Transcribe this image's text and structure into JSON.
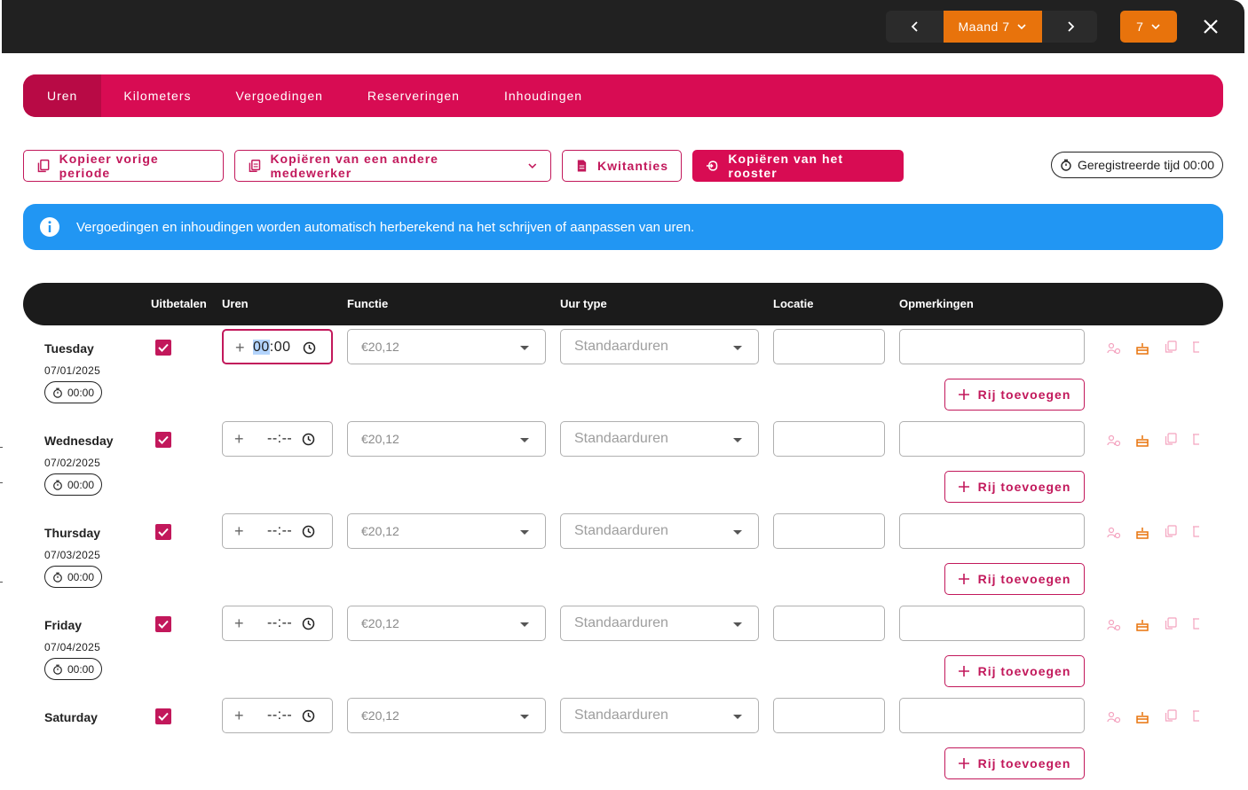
{
  "header": {
    "month_label": "Maand 7",
    "week_label": "7"
  },
  "tabs": [
    {
      "label": "Uren",
      "active": true
    },
    {
      "label": "Kilometers",
      "active": false
    },
    {
      "label": "Vergoedingen",
      "active": false
    },
    {
      "label": "Reserveringen",
      "active": false
    },
    {
      "label": "Inhoudingen",
      "active": false
    }
  ],
  "actions": {
    "copy_previous": "Kopieer vorige periode",
    "copy_other_employee": "Kopiëren van een andere medewerker",
    "receipts": "Kwitanties",
    "copy_schedule": "Kopiëren van het rooster",
    "registered_time": "Geregistreerde tijd 00:00"
  },
  "info_message": "Vergoedingen en inhoudingen worden automatisch herberekend na het schrijven of aanpassen van uren.",
  "table_headers": {
    "payout": "Uitbetalen",
    "hours": "Uren",
    "function": "Functie",
    "hour_type": "Uur type",
    "location": "Locatie",
    "remarks": "Opmerkingen"
  },
  "add_row_label": "Rij toevoegen",
  "days": [
    {
      "name": "Tuesday",
      "date": "07/01/2025",
      "total": "00:00",
      "hours_hh": "00",
      "hours_rest": ":00",
      "function": "€20,12",
      "hour_type": "Standaarduren",
      "checked": true
    },
    {
      "name": "Wednesday",
      "date": "07/02/2025",
      "total": "00:00",
      "hours_hh": "",
      "hours_rest": "--:--",
      "function": "€20,12",
      "hour_type": "Standaarduren",
      "checked": true
    },
    {
      "name": "Thursday",
      "date": "07/03/2025",
      "total": "00:00",
      "hours_hh": "",
      "hours_rest": "--:--",
      "function": "€20,12",
      "hour_type": "Standaarduren",
      "checked": true
    },
    {
      "name": "Friday",
      "date": "07/04/2025",
      "total": "00:00",
      "hours_hh": "",
      "hours_rest": "--:--",
      "function": "€20,12",
      "hour_type": "Standaarduren",
      "checked": true
    },
    {
      "name": "Saturday",
      "date": "",
      "total": "",
      "hours_hh": "",
      "hours_rest": "--:--",
      "function": "€20,12",
      "hour_type": "Standaarduren",
      "checked": true
    }
  ],
  "colors": {
    "brand": "#d80c53",
    "accent_orange": "#e8730c",
    "info_blue": "#2196f3",
    "dark": "#212121"
  },
  "icons": {
    "prev": "chevron-left-icon",
    "next": "chevron-right-icon",
    "close": "close-icon",
    "info": "info-icon",
    "timer": "stopwatch-icon",
    "clock": "clock-icon"
  }
}
